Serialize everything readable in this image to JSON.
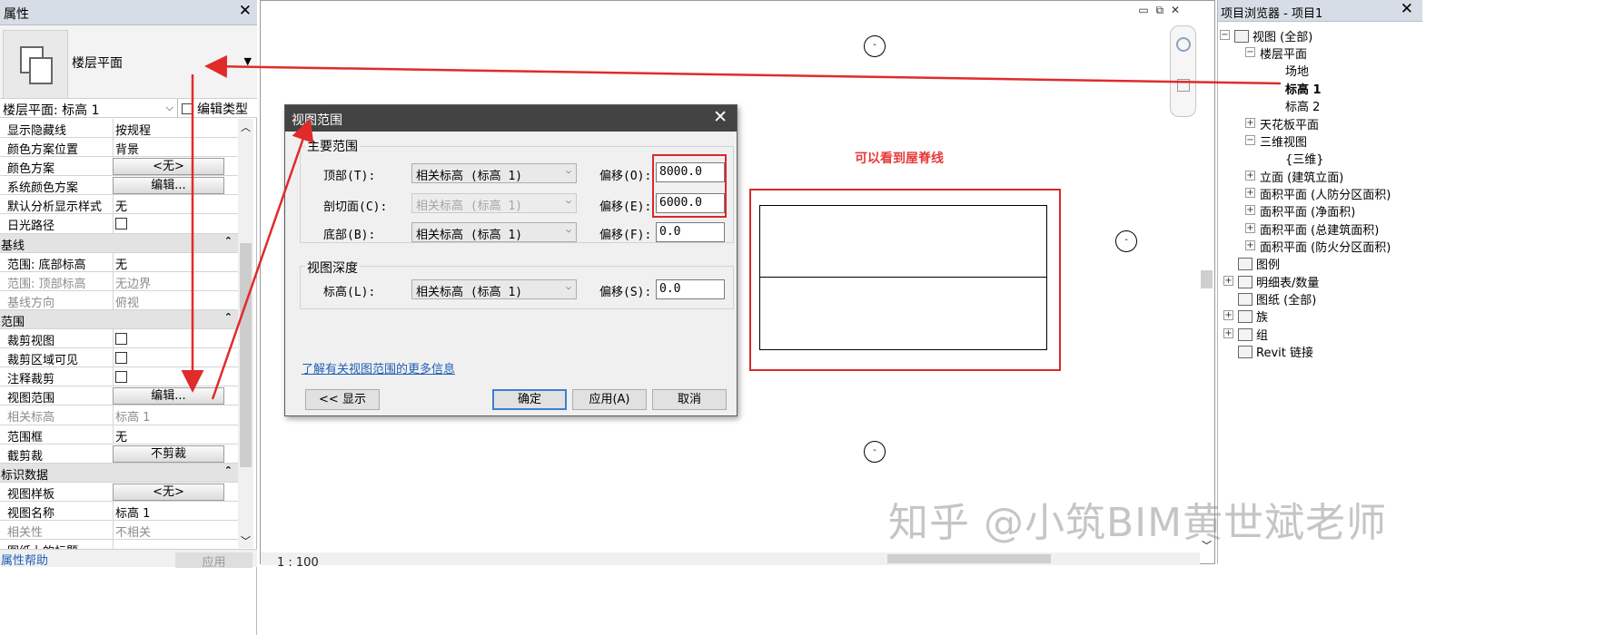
{
  "properties": {
    "title": "属性",
    "close": "✕",
    "type_name": "楼层平面",
    "instance": "楼层平面: 标高 1",
    "edit_type": "编辑类型",
    "rows": [
      {
        "k": "显示隐藏线",
        "v": "按规程"
      },
      {
        "k": "颜色方案位置",
        "v": "背景"
      },
      {
        "k": "颜色方案",
        "btn": "<无>"
      },
      {
        "k": "系统颜色方案",
        "btn": "编辑..."
      },
      {
        "k": "默认分析显示样式",
        "v": "无"
      },
      {
        "k": "日光路径",
        "chk": true
      },
      {
        "k": "基线",
        "group": true
      },
      {
        "k": "范围: 底部标高",
        "v": "无"
      },
      {
        "k": "范围: 顶部标高",
        "v": "无边界",
        "dis": true
      },
      {
        "k": "基线方向",
        "v": "俯视",
        "dis": true
      },
      {
        "k": "范围",
        "group": true
      },
      {
        "k": "裁剪视图",
        "chk": true
      },
      {
        "k": "裁剪区域可见",
        "chk": true
      },
      {
        "k": "注释裁剪",
        "chk": true
      },
      {
        "k": "视图范围",
        "btn": "编辑..."
      },
      {
        "k": "相关标高",
        "v": "标高 1",
        "dis": true
      },
      {
        "k": "范围框",
        "v": "无"
      },
      {
        "k": "截剪裁",
        "btn": "不剪裁"
      },
      {
        "k": "标识数据",
        "group": true
      },
      {
        "k": "视图样板",
        "btn": "<无>"
      },
      {
        "k": "视图名称",
        "v": "标高 1"
      },
      {
        "k": "相关性",
        "v": "不相关",
        "dis": true
      },
      {
        "k": "图纸上的标题",
        "v": ""
      }
    ],
    "help": "属性帮助",
    "apply": "应用"
  },
  "canvas": {
    "annotation": "可以看到屋脊线",
    "status": "1 : 100"
  },
  "dialog": {
    "title": "视图范围",
    "primary": "主要范围",
    "top_label": "顶部(T):",
    "top_level": "相关标高 (标高 1)",
    "top_offset_label": "偏移(O):",
    "top_offset": "8000.0",
    "cut_label": "剖切面(C):",
    "cut_level": "相关标高 (标高 1)",
    "cut_offset_label": "偏移(E):",
    "cut_offset": "6000.0",
    "bottom_label": "底部(B):",
    "bottom_level": "相关标高 (标高 1)",
    "bottom_offset_label": "偏移(F):",
    "bottom_offset": "0.0",
    "depth": "视图深度",
    "depth_label": "标高(L):",
    "depth_level": "相关标高 (标高 1)",
    "depth_offset_label": "偏移(S):",
    "depth_offset": "0.0",
    "link": "了解有关视图范围的更多信息",
    "show": "<< 显示",
    "ok": "确定",
    "apply": "应用(A)",
    "cancel": "取消"
  },
  "browser": {
    "title": "项目浏览器 - 项目1",
    "nodes": [
      "视图 (全部)",
      "楼层平面",
      "场地",
      "标高 1",
      "标高 2",
      "天花板平面",
      "三维视图",
      "{三维}",
      "立面 (建筑立面)",
      "面积平面 (人防分区面积)",
      "面积平面 (净面积)",
      "面积平面 (总建筑面积)",
      "面积平面 (防火分区面积)",
      "图例",
      "明细表/数量",
      "图纸 (全部)",
      "族",
      "组",
      "Revit 链接"
    ]
  },
  "watermark": "知乎 @小筑BIM黄世斌老师",
  "colors": {
    "annotation": "#e63a3a",
    "title_bar": "#434343",
    "panel_header": "#d7dde6",
    "link": "#1f5fb7"
  }
}
